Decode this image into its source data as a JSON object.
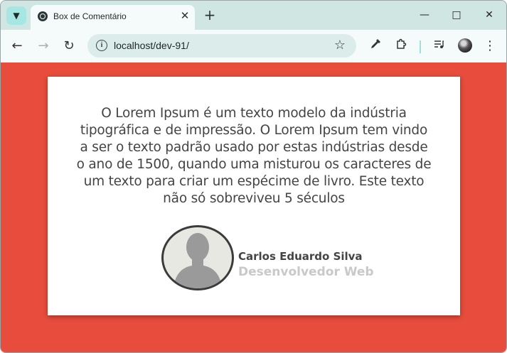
{
  "browser": {
    "tab_title": "Box de Comentário",
    "url": "localhost/dev-91/"
  },
  "testimonial": {
    "text": "O Lorem Ipsum é um texto modelo da indústria tipográfica e de impressão. O Lorem Ipsum tem vindo a ser o texto padrão usado por estas indústrias desde o ano de 1500, quando uma misturou os caracteres de um texto para criar um espécime de livro. Este texto não só sobreviveu 5 séculos",
    "author_name": "Carlos Eduardo Silva",
    "author_role": "Desenvolvedor Web"
  },
  "colors": {
    "page_background": "#e74c3c",
    "card_background": "#ffffff",
    "text": "#444444",
    "role_text": "#c9c9c9"
  },
  "icons": [
    "tab-search-icon",
    "globe-icon",
    "close-icon",
    "plus-icon",
    "minimize-icon",
    "maximize-icon",
    "window-close-icon",
    "back-icon",
    "forward-icon",
    "reload-icon",
    "site-info-icon",
    "bookmark-star-icon",
    "eyedropper-icon",
    "extensions-icon",
    "media-control-icon",
    "profile-avatar",
    "menu-icon",
    "person-placeholder-icon"
  ]
}
